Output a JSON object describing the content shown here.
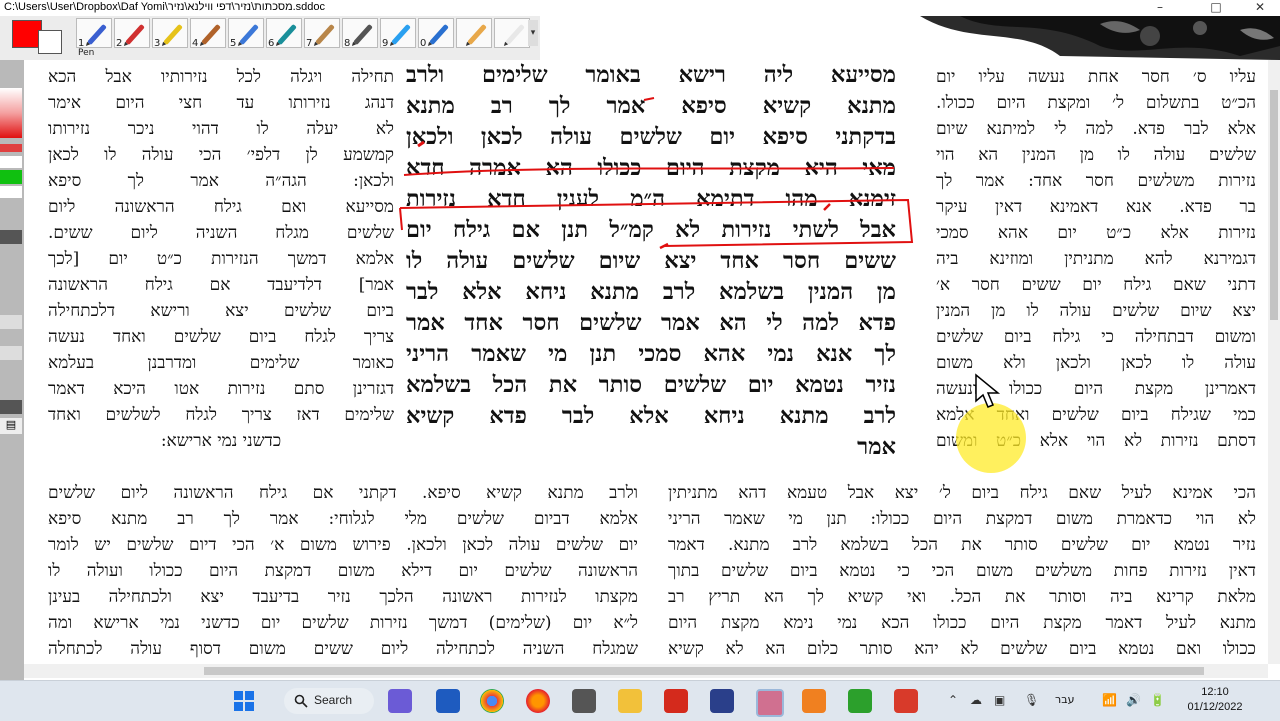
{
  "window": {
    "title": "C:\\Users\\User\\Dropbox\\Daf Yomi\\מסכתות\\נזיר\\דפי ווילנא\\נזיר.sddoc",
    "min": "–",
    "max": "□",
    "close": "✕"
  },
  "toolbar": {
    "primary_color": "#ff0000",
    "secondary_color": "#ffffff",
    "pen_label": "Pen",
    "more": "▾",
    "tools": [
      {
        "num": "1",
        "color": "#3a5fd0"
      },
      {
        "num": "2",
        "color": "#d03030"
      },
      {
        "num": "3",
        "color": "#e6c21a"
      },
      {
        "num": "4",
        "color": "#b0622a"
      },
      {
        "num": "5",
        "color": "#3c78d8"
      },
      {
        "num": "6",
        "color": "#1a8f9a"
      },
      {
        "num": "7",
        "color": "#b8864a"
      },
      {
        "num": "8",
        "color": "#555555"
      },
      {
        "num": "9",
        "color": "#2aa0f0"
      },
      {
        "num": "0",
        "color": "#2a70d0"
      },
      {
        "num": "",
        "color": "#e8a84a"
      },
      {
        "num": "",
        "color": "#e8e8e8"
      }
    ]
  },
  "rashi_left": [
    "תחילה ויגלה לכל נזירותיו אבל הכא",
    "דנהג נזירותו עד חצי היום אימר",
    "לא יעלה לו דהוי ניכר נזירותו",
    "קמשמע לן דלפי׳ הכי עולה לו לכאן",
    "ולכאן: הגה״ה אמר לך סיפא",
    "מסייעא ואם גילח הראשונה ליום",
    "שלשים מגלח השניה ליום ששים.",
    "אלמא דמשך הנזירות כ״ט יום [לכך",
    "אמר] דלדיעבד אם גילח הראשונה",
    "ביום שלשים יצא ורישא דלכתחילה",
    "צריך לגלח ביום שלשים ואחד נעשה",
    "כאומר שלימים ומדרבנן בעלמא",
    "דגזרינן סתם נזירות אטו היכא דאמר",
    "שלימים דאז צריך לגלח לשלשים ואחד",
    "כדשני נמי ארישא:"
  ],
  "main_text": [
    "מסייעא ליה רישא באומר שלימים ולרב",
    "מתנא קשיא סיפא אמר לך רב מתנא",
    "בדקתני סיפא יום שלשים עולה לכאן ולכאן",
    "מאי היא מקצת היום ככולו הא אמרה חדא",
    "זימנא מהו דתימא ה״מ לענין חדא נזירות",
    "אבל לשתי נזירות לא קמ״ל תנן אם גילח יום",
    "ששים חסר אחד יצא שיום שלשים עולה לו",
    "מן המנין בשלמא לרב מתנא ניחא אלא לבר",
    "פדא למה לי הא אמר שלשים חסר אחד אמר",
    "לך אנא נמי אהא סמכי תנן מי שאמר הריני",
    "נזיר נטמא יום שלשים סותר את הכל בשלמא",
    "לרב מתנא ניחא אלא לבר פדא קשיא",
    "אמר"
  ],
  "rashi_right": [
    "עליו ס׳ חסר אחת נעשה עליו יום",
    "הכ״ט בתשלום ל׳ ומקצת היום ככולו.",
    "אלא לבר פדא. למה לי למיתנא שיום",
    "שלשים עולה לו מן המנין הא הוי",
    "נזירות משלשים חסר אחד: אמר לך",
    "בר פדא. אנא דאמינא דאין עיקר",
    "נזירות אלא כ״ט יום אהא סמכי",
    "דגמירנא להא מתניתין ומוזינא ביה",
    "דתני שאם גילח יום ששים חסר א׳",
    "יצא שיום שלשים עולה לו מן המנין",
    "ומשום דבתחילה כי גילח ביום שלשים",
    "עולה לו לכאן ולכאן ולא משום",
    "דאמרינן מקצת היום ככולו ונעשה",
    "כמי שגילח ביום שלשים ואחד אלמא",
    "דסתם נזירות לא הוי אלא כ״ט ומשום"
  ],
  "bottom_left": [
    "ולרב מתנא קשיא סיפא. דקתני אם גילח הראשונה ליום שלשים",
    "אלמא דביום שלשים מלי לגלוחי: אמר לך רב מתנא סיפא",
    "יום שלשים עולה לכאן ולכאן. פירוש משום א׳ הכי דיום שלשים יש לומר",
    "הראשונה שלשים יום דילא משום דמקצת היום ככולו ועולה לו",
    "מקצתו לנזירות ראשונה הלכך נזיר בדיעבד יצא ולכתחילה בעינן",
    "ל״א יום (שלימים) דמשך נזירות שלשים יום כדשני נמי ארישא ומה",
    "שמגלח השניה לכתחילה ליום ששים משום דסוף עולה לכתחלה"
  ],
  "bottom_right": [
    "הכי אמינא לעיל שאם גילח ביום ל׳ יצא אבל טעמא דהא מתניתין",
    "לא הוי כדאמרת משום דמקצת היום ככולו: תנן מי שאמר הריני",
    "נזיר נטמא יום שלשים סותר את הכל בשלמא לרב מתנא. דאמר",
    "דאין נזירות פחות משלשים משום הכי כי נטמא ביום שלשים בתוך",
    "מלאת קרינא ביה וסותר את הכל. ואי קשיא לך הא תריץ רב",
    "מתנא לעיל דאמר מקצת היום ככולו הכא נמי נימא מקצת היום",
    "ככולו ואם נטמא ביום שלשים לא יהא סותר כלום הא לא קשיא"
  ],
  "taskbar": {
    "search_label": "Search",
    "language": "עבר",
    "time": "12:10",
    "date": "01/12/2022"
  }
}
